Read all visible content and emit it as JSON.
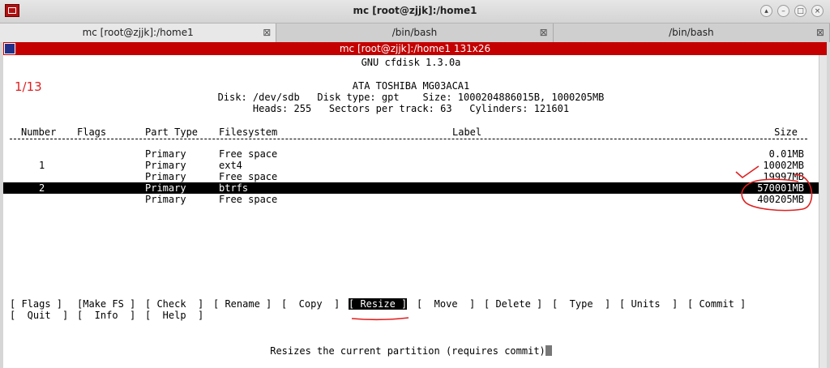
{
  "window": {
    "title": "mc [root@zjjk]:/home1"
  },
  "tabs": [
    {
      "label": "mc [root@zjjk]:/home1",
      "active": true
    },
    {
      "label": "/bin/bash",
      "active": false
    },
    {
      "label": "/bin/bash",
      "active": false
    }
  ],
  "terminal_title": "mc [root@zjjk]:/home1 131x26",
  "annotation": {
    "counter": "1/13"
  },
  "cfdisk": {
    "version": "GNU cfdisk 1.3.0a",
    "disk_model": "ATA TOSHIBA MG03ACA1",
    "disk_line": "Disk: /dev/sdb   Disk type: gpt    Size: 1000204886015B, 1000205MB",
    "geometry_line": "Heads: 255   Sectors per track: 63   Cylinders: 121601",
    "headers": {
      "number": "Number",
      "flags": "Flags",
      "part_type": "Part Type",
      "filesystem": "Filesystem",
      "label": "Label",
      "size": "Size"
    },
    "partitions": [
      {
        "number": "",
        "part_type": "Primary",
        "filesystem": "Free space",
        "size": "0.01MB",
        "selected": false
      },
      {
        "number": "1",
        "part_type": "Primary",
        "filesystem": "ext4",
        "size": "10002MB",
        "selected": false
      },
      {
        "number": "",
        "part_type": "Primary",
        "filesystem": "Free space",
        "size": "19997MB",
        "selected": false
      },
      {
        "number": "2",
        "part_type": "Primary",
        "filesystem": "btrfs",
        "size": "570001MB",
        "selected": true
      },
      {
        "number": "",
        "part_type": "Primary",
        "filesystem": "Free space",
        "size": "400205MB",
        "selected": false
      }
    ],
    "menu": {
      "flags": "[ Flags ]",
      "make_fs": "[Make FS ]",
      "check": "[ Check  ]",
      "rename": "[ Rename ]",
      "copy": "[  Copy  ]",
      "resize": "[ Resize ]",
      "move": "[  Move  ]",
      "delete": "[ Delete ]",
      "type": "[  Type  ]",
      "units": "[ Units  ]",
      "commit": "[ Commit ]",
      "quit": "[  Quit  ]",
      "info": "[  Info  ]",
      "help": "[  Help  ]"
    },
    "status": "Resizes the current partition (requires commit)"
  },
  "colors": {
    "terminal_bar": "#c40000",
    "annotation": "#e02020"
  },
  "icons": {
    "app": "terminal-app-icon",
    "terminal": "terminal-icon"
  }
}
